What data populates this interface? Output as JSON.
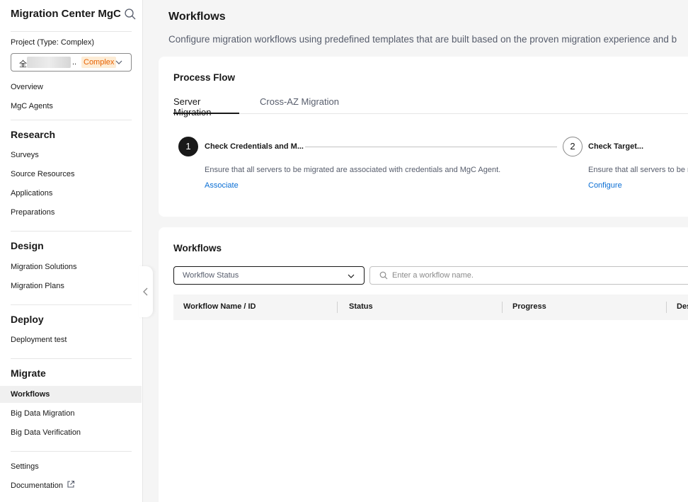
{
  "sidebar": {
    "app_title": "Migration Center MgC",
    "project_label": "Project (Type: Complex)",
    "project_value_prefix": "全",
    "project_value_suffix": "..",
    "project_badge": "Complex",
    "items_top": [
      "Overview",
      "MgC Agents"
    ],
    "research": {
      "heading": "Research",
      "items": [
        "Surveys",
        "Source Resources",
        "Applications",
        "Preparations"
      ]
    },
    "design": {
      "heading": "Design",
      "items": [
        "Migration Solutions",
        "Migration Plans"
      ]
    },
    "deploy": {
      "heading": "Deploy",
      "items": [
        "Deployment test"
      ]
    },
    "migrate": {
      "heading": "Migrate",
      "items": [
        "Workflows",
        "Big Data Migration",
        "Big Data Verification"
      ],
      "active": "Workflows"
    },
    "items_bottom": [
      "Settings",
      "Documentation"
    ]
  },
  "page": {
    "title": "Workflows",
    "description": "Configure migration workflows using predefined templates that are built based on the proven migration experience and b"
  },
  "process_flow": {
    "title": "Process Flow",
    "tabs": [
      "Server Migration",
      "Cross-AZ Migration"
    ],
    "active_tab": "Server Migration",
    "steps": [
      {
        "number": "1",
        "title": "Check Credentials and M...",
        "description": "Ensure that all servers to be migrated are associated with credentials and MgC Agent.",
        "link": "Associate"
      },
      {
        "number": "2",
        "title": "Check Target...",
        "description": "Ensure that all servers to be m",
        "link": "Configure"
      }
    ]
  },
  "workflows": {
    "title": "Workflows",
    "status_filter_placeholder": "Workflow Status",
    "search_placeholder": "Enter a workflow name.",
    "columns": [
      "Workflow Name / ID",
      "Status",
      "Progress",
      "Des"
    ]
  },
  "colors": {
    "accent_link": "#0a6ed4",
    "badge_text": "#e86100",
    "badge_bg": "#fdecd5",
    "active_step": "#191919"
  }
}
